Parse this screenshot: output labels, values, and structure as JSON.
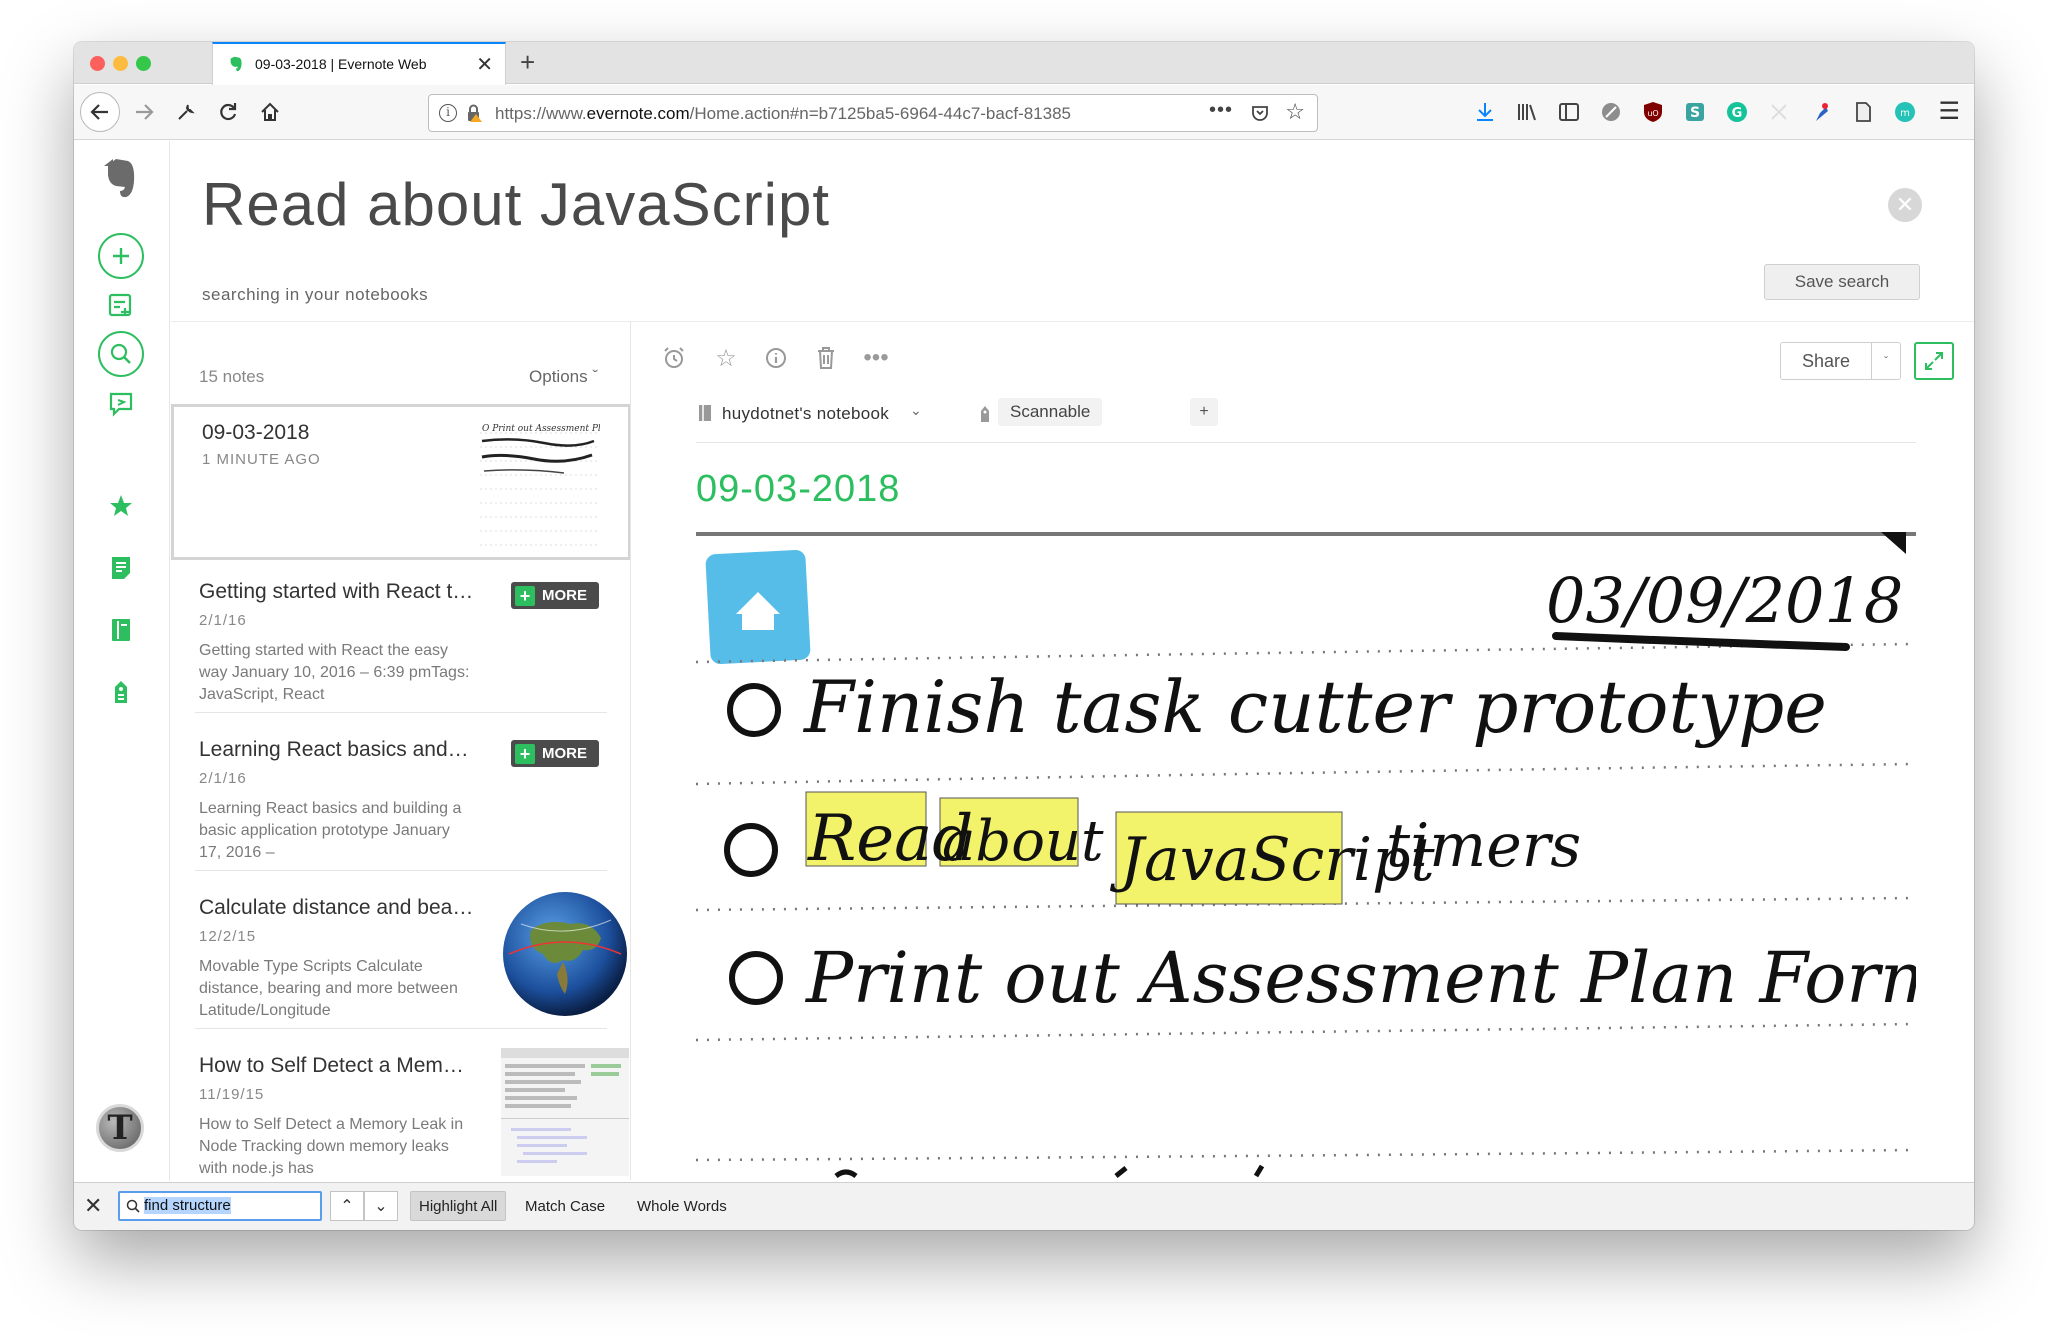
{
  "browser": {
    "tab_title": "09-03-2018 | Evernote Web",
    "url_prefix": "https://www.",
    "url_domain": "evernote.com",
    "url_rest": "/Home.action#n=b7125ba5-6964-44c7-bacf-81385"
  },
  "header": {
    "title": "Read about JavaScript",
    "subtitle": "searching in your notebooks",
    "save_search_label": "Save search"
  },
  "note_list": {
    "count": "15 notes",
    "options_label": "Options",
    "notes": [
      {
        "title": "09-03-2018",
        "date": "1 MINUTE AGO",
        "snippet": ""
      },
      {
        "title": "Getting started with React the easy way",
        "date": "2/1/16",
        "snippet": "Getting started with React the easy way January 10, 2016 – 6:39 pmTags: JavaScript, React",
        "badge": "MORE"
      },
      {
        "title": "Learning React basics and building a basic application",
        "date": "2/1/16",
        "snippet": "Learning React basics and building a basic application prototype January 17, 2016 –",
        "badge": "MORE"
      },
      {
        "title": "Calculate distance and bearing",
        "date": "12/2/15",
        "snippet": "Movable Type Scripts Calculate distance, bearing and more between Latitude/Longitude"
      },
      {
        "title": "How to Self Detect a Memory Leak in Node",
        "date": "11/19/15",
        "snippet": "How to Self Detect a Memory Leak in Node Tracking down memory leaks with node.js has"
      }
    ]
  },
  "editor": {
    "share_label": "Share",
    "notebook": "huydotnet's notebook",
    "tag": "Scannable",
    "tag_add": "+",
    "note_title": "09-03-2018",
    "handwriting": {
      "date": "03/09/2018",
      "line1": "Finish task cutter prototype",
      "line2_words": [
        "Read",
        "about",
        "JavaScript",
        "timers"
      ],
      "line3": "Print out Assessment Plan Form"
    }
  },
  "find_bar": {
    "query": "find structure",
    "highlight_all": "Highlight All",
    "match_case": "Match Case",
    "whole_words": "Whole Words"
  },
  "colors": {
    "evernote_green": "#2dbe60",
    "highlight_yellow": "#f3f36b",
    "accent_blue": "#0a84ff"
  }
}
